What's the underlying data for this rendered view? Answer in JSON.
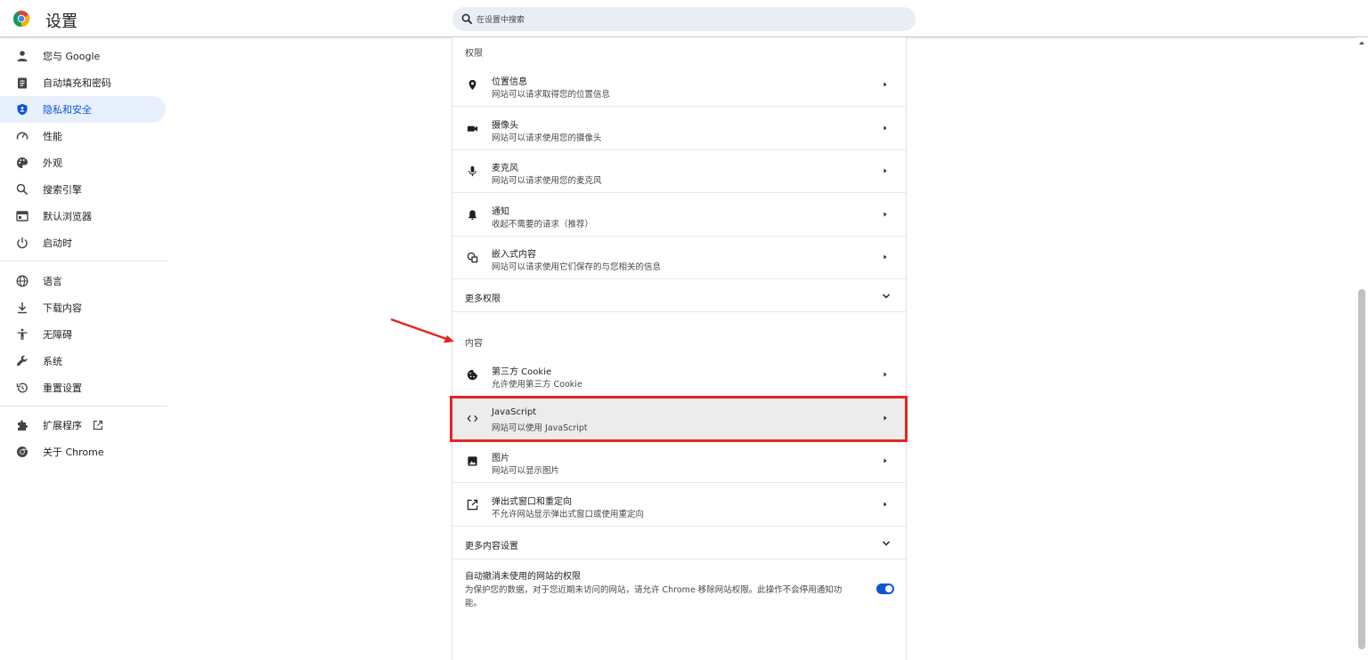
{
  "app": {
    "title": "设置"
  },
  "search": {
    "placeholder": "在设置中搜索"
  },
  "sidebar": {
    "items": [
      {
        "label": "您与 Google",
        "icon": "person-icon"
      },
      {
        "label": "自动填充和密码",
        "icon": "clipboard-icon"
      },
      {
        "label": "隐私和安全",
        "icon": "shield-icon",
        "active": true
      },
      {
        "label": "性能",
        "icon": "speedometer-icon"
      },
      {
        "label": "外观",
        "icon": "palette-icon"
      },
      {
        "label": "搜索引擎",
        "icon": "search-icon"
      },
      {
        "label": "默认浏览器",
        "icon": "browser-icon"
      },
      {
        "label": "启动时",
        "icon": "power-icon"
      },
      {
        "label": "语言",
        "icon": "globe-icon"
      },
      {
        "label": "下载内容",
        "icon": "download-icon"
      },
      {
        "label": "无障碍",
        "icon": "accessibility-icon"
      },
      {
        "label": "系统",
        "icon": "wrench-icon"
      },
      {
        "label": "重置设置",
        "icon": "reset-icon"
      },
      {
        "label": "扩展程序",
        "icon": "puzzle-icon"
      },
      {
        "label": "关于 Chrome",
        "icon": "chrome-icon"
      }
    ]
  },
  "permissions": {
    "title": "权限",
    "rows": [
      {
        "title": "位置信息",
        "subtitle": "网站可以请求取得您的位置信息",
        "icon": "location-icon"
      },
      {
        "title": "摄像头",
        "subtitle": "网站可以请求使用您的摄像头",
        "icon": "camera-icon"
      },
      {
        "title": "麦克风",
        "subtitle": "网站可以请求使用您的麦克风",
        "icon": "microphone-icon"
      },
      {
        "title": "通知",
        "subtitle": "收起不需要的请求（推荐）",
        "icon": "bell-icon"
      },
      {
        "title": "嵌入式内容",
        "subtitle": "网站可以请求使用它们保存的与您相关的信息",
        "icon": "embedded-content-icon"
      }
    ],
    "more": "更多权限"
  },
  "content": {
    "title": "内容",
    "rows": [
      {
        "title": "第三方 Cookie",
        "subtitle": "允许使用第三方 Cookie",
        "icon": "cookie-icon"
      },
      {
        "title": "JavaScript",
        "subtitle": "网站可以使用 JavaScript",
        "icon": "code-icon",
        "highlighted": true
      },
      {
        "title": "图片",
        "subtitle": "网站可以显示图片",
        "icon": "image-icon"
      },
      {
        "title": "弹出式窗口和重定向",
        "subtitle": "不允许网站显示弹出式窗口或使用重定向",
        "icon": "open-in-new-icon"
      }
    ],
    "more": "更多内容设置"
  },
  "auto_revoke": {
    "title": "自动撤消未使用的网站的权限",
    "description": "为保护您的数据，对于您近期未访问的网站，请允许 Chrome 移除网站权限。此操作不会停用通知功能。",
    "enabled": true
  },
  "colors": {
    "accent": "#0b57d0",
    "active_bg": "#e8f0fe",
    "annotation": "#e52521"
  }
}
